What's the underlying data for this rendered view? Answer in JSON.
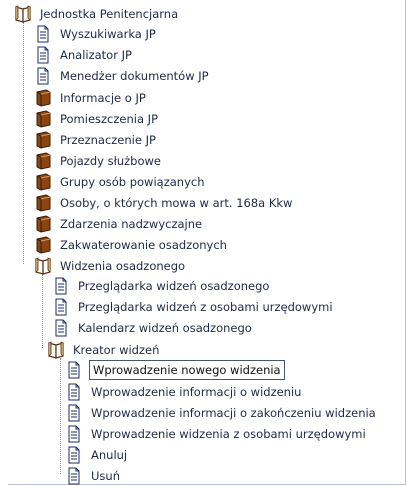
{
  "tree": {
    "root": "Jednostka Penitencjarna",
    "jp_pages": [
      "Wyszukiwarka JP",
      "Analizator JP",
      "Menedżer dokumentów JP"
    ],
    "jp_books": [
      "Informacje o JP",
      "Pomieszczenia JP",
      "Przeznaczenie JP",
      "Pojazdy służbowe",
      "Grupy osób powiązanych",
      "Osoby, o których mowa w art. 168a Kkw",
      "Zdarzenia nadzwyczajne",
      "Zakwaterowanie osadzonych"
    ],
    "visits": "Widzenia osadzonego",
    "visits_pages": [
      "Przeglądarka widzeń osadzonego",
      "Przeglądarka widzeń z osobami urzędowymi",
      "Kalendarz widzeń osadzonego"
    ],
    "creator": "Kreator widzeń",
    "creator_pages": [
      "Wprowadzenie nowego widzenia",
      "Wprowadzenie informacji o widzeniu",
      "Wprowadzenie informacji o zakończeniu widzenia",
      "Wprowadzenie widzenia z osobami urzędowymi",
      "Anuluj",
      "Usuń"
    ],
    "selected": "Wprowadzenie nowego widzenia"
  },
  "icons": {
    "open_folder": "open-book-icon",
    "closed_folder": "closed-book-icon",
    "page": "document-page-icon"
  },
  "colors": {
    "text": "#1f2a44",
    "tree_line": "#8a97ad",
    "book": "#8b4513",
    "book_dark": "#5a2d0c"
  }
}
